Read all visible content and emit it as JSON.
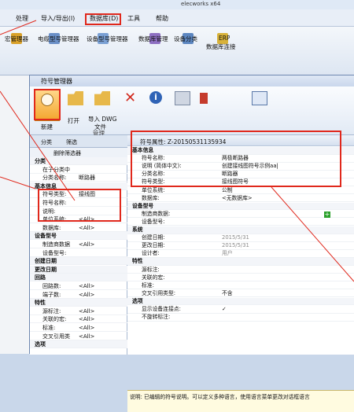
{
  "app": {
    "title": "elecworks x64",
    "menus": [
      "处理",
      "导入/导出(I)",
      "数据库(D)",
      "工具",
      "帮助"
    ],
    "ribbon": [
      "宏管理器",
      "电缆型号管理器",
      "设备型号管理器",
      "数据库管理",
      "设备分类",
      "ERP",
      "数据库连接"
    ]
  },
  "dialog": {
    "title": "符号管理器",
    "toolbar": {
      "new": "新建",
      "open": "打开",
      "import": "导入 DWG",
      "import2": "文件",
      "manage": "管理"
    },
    "tabs": {
      "category": "分类",
      "filter": "筛选",
      "filter_name": "删除筛选器"
    }
  },
  "left_panel": {
    "rows": [
      {
        "label": "分类",
        "value": "",
        "cat": true
      },
      {
        "label": "在子分类中",
        "value": ""
      },
      {
        "label": "分类名称:",
        "value": "断路器"
      },
      {
        "label": "基本信息",
        "value": "",
        "cat": true
      },
      {
        "label": "符号类型:",
        "value": "接线图"
      },
      {
        "label": "符号名称:",
        "value": ""
      },
      {
        "label": "说明:",
        "value": ""
      },
      {
        "label": "单位系统:",
        "value": "<All>"
      },
      {
        "label": "数据库:",
        "value": "<All>"
      },
      {
        "label": "设备型号",
        "value": "",
        "cat": true
      },
      {
        "label": "制造商数据",
        "value": "<All>"
      },
      {
        "label": "设备型号:",
        "value": ""
      },
      {
        "label": "创建日期",
        "value": "",
        "cat": true
      },
      {
        "label": "更改日期",
        "value": "",
        "cat": true
      },
      {
        "label": "回路",
        "value": "",
        "cat": true
      },
      {
        "label": "回路数:",
        "value": "<All>"
      },
      {
        "label": "端子数:",
        "value": "<All>"
      },
      {
        "label": "特性",
        "value": "",
        "cat": true
      },
      {
        "label": "源标注:",
        "value": "<All>"
      },
      {
        "label": "关联的宏:",
        "value": "<All>"
      },
      {
        "label": "标准:",
        "value": "<All>"
      },
      {
        "label": "交叉引用类",
        "value": "<All>"
      },
      {
        "label": "选项",
        "value": "",
        "cat": true
      }
    ]
  },
  "right_panel": {
    "header": "符号属性: Z-20150531135934",
    "rows": [
      {
        "label": "基本信息",
        "value": "",
        "cat": true
      },
      {
        "label": "符号名称:",
        "value": "两极断路器"
      },
      {
        "label": "说明 (简体中文):",
        "value": "创建接线图符号示例aa|"
      },
      {
        "label": "分类名称:",
        "value": "断路器"
      },
      {
        "label": "符号类型:",
        "value": "接线图符号"
      },
      {
        "label": "单位系统:",
        "value": "公制"
      },
      {
        "label": "数据库:",
        "value": "<无数据库>"
      },
      {
        "label": "设备型号",
        "value": "",
        "cat": true
      },
      {
        "label": "制造商数据:",
        "value": ""
      },
      {
        "label": "设备型号:",
        "value": ""
      },
      {
        "label": "系统",
        "value": "",
        "cat": true
      },
      {
        "label": "创建日期:",
        "value": "2015/5/31",
        "grey": true
      },
      {
        "label": "更改日期:",
        "value": "2015/5/31",
        "grey": true
      },
      {
        "label": "设计者:",
        "value": "用户",
        "grey": true
      },
      {
        "label": "特性",
        "value": "",
        "cat": true
      },
      {
        "label": "源标注:",
        "value": ""
      },
      {
        "label": "关联的宏:",
        "value": ""
      },
      {
        "label": "标准:",
        "value": ""
      },
      {
        "label": "交叉引用类型:",
        "value": "不含"
      },
      {
        "label": "选项",
        "value": "",
        "cat": true
      },
      {
        "label": "显示设备连接点:",
        "value": "✓"
      },
      {
        "label": "不旋转标注:",
        "value": ""
      }
    ],
    "description": "说明: 已编辑的符号说明。可以定义多种语言，使用语言菜单更改对话框语言"
  },
  "colors": {
    "accent": "#e0281c"
  }
}
